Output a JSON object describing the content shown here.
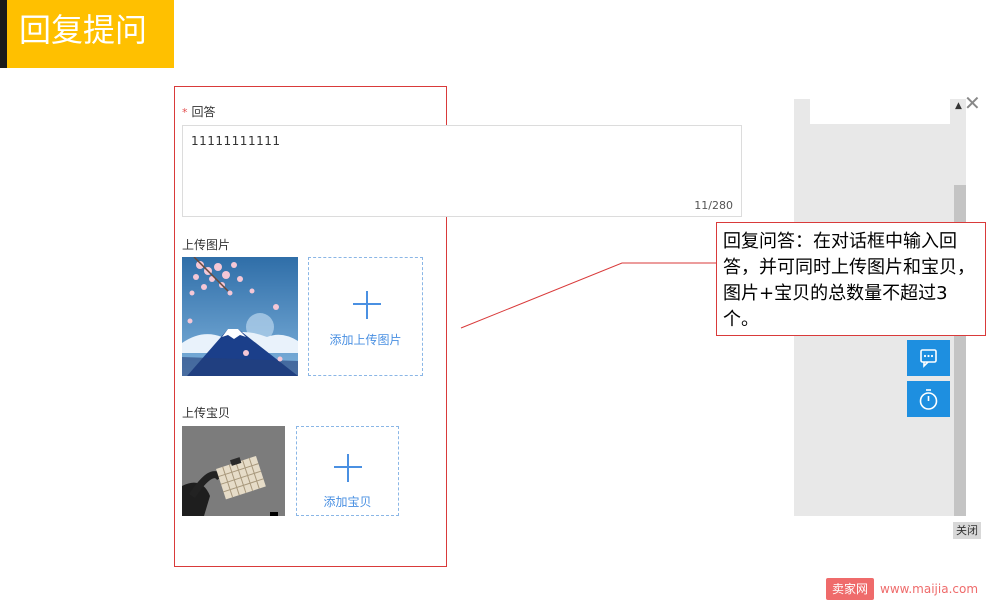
{
  "page": {
    "title": "回复提问"
  },
  "form": {
    "answer": {
      "required_mark": "*",
      "label": "回答",
      "value": "11111111111",
      "counter": "11/280"
    },
    "images": {
      "label": "上传图片",
      "add_label": "添加上传图片"
    },
    "items": {
      "label": "上传宝贝",
      "add_label": "添加宝贝"
    }
  },
  "callout": {
    "text": "回复问答：在对话框中输入回答，并可同时上传图片和宝贝，图片+宝贝的总数量不超过3个。"
  },
  "side_panel": {
    "close_label": "关闭",
    "close_icon": "close-x-icon",
    "buttons": [
      "chat-bubble-icon",
      "stopwatch-icon"
    ]
  },
  "watermark": {
    "brand": "卖家网",
    "url": "www.maijia.com"
  },
  "colors": {
    "banner": "#ffc000",
    "frame": "#d93a3a",
    "accent": "#4a90e2",
    "float_button": "#1e8fe0"
  }
}
